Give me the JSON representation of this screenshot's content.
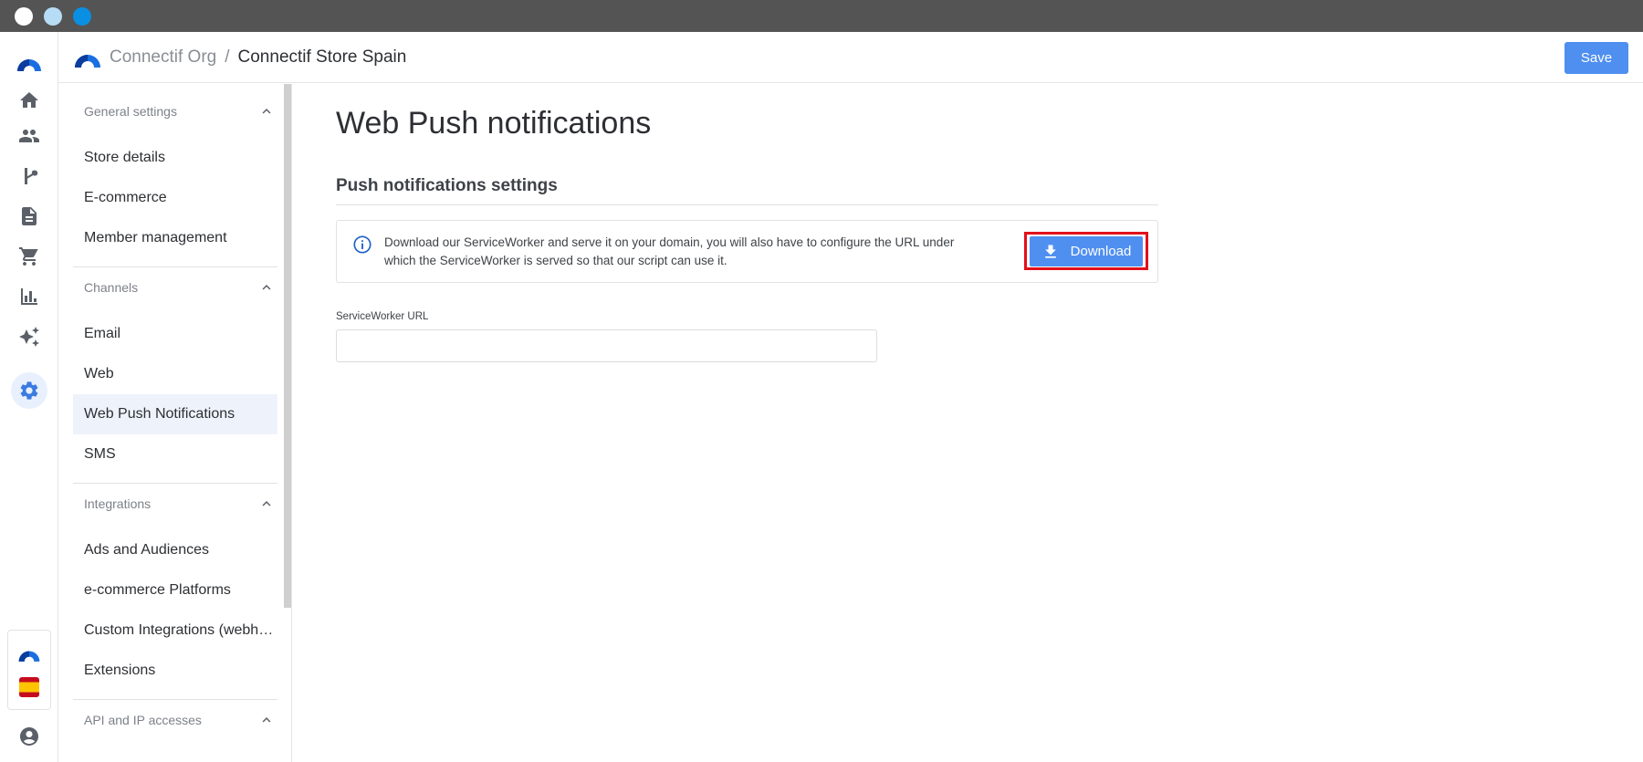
{
  "header": {
    "org_name": "Connectif Org",
    "separator": "/",
    "store_name": "Connectif Store Spain",
    "save_label": "Save"
  },
  "rail": {
    "icons": [
      "home-icon",
      "people-icon",
      "workflow-icon",
      "document-icon",
      "cart-icon",
      "bar-chart-icon",
      "sparkles-icon",
      "gear-icon"
    ],
    "active": "gear-icon",
    "bottom_icons": [
      "connectif-logo-icon",
      "spain-flag-icon",
      "account-circle-icon"
    ]
  },
  "nav": {
    "sections": [
      {
        "label": "General settings",
        "items": [
          "Store details",
          "E-commerce",
          "Member management"
        ]
      },
      {
        "label": "Channels",
        "items": [
          "Email",
          "Web",
          "Web Push Notifications",
          "SMS"
        ]
      },
      {
        "label": "Integrations",
        "items": [
          "Ads and Audiences",
          "e-commerce Platforms",
          "Custom Integrations (webhooks)",
          "Extensions"
        ]
      },
      {
        "label": "API and IP accesses",
        "items": []
      }
    ],
    "active_item": "Web Push Notifications"
  },
  "main": {
    "page_title": "Web Push notifications",
    "section_title": "Push notifications settings",
    "info_text": "Download our ServiceWorker and serve it on your domain, you will also have to configure the URL under which the ServiceWorker is served so that our script can use it.",
    "download_label": "Download",
    "field_label": "ServiceWorker URL",
    "field_value": "",
    "field_placeholder": ""
  },
  "colors": {
    "accent": "#4f8ff0",
    "highlight_frame": "#e2101a",
    "titlebar": "#545454",
    "nav_active_bg": "#eef3fb"
  }
}
